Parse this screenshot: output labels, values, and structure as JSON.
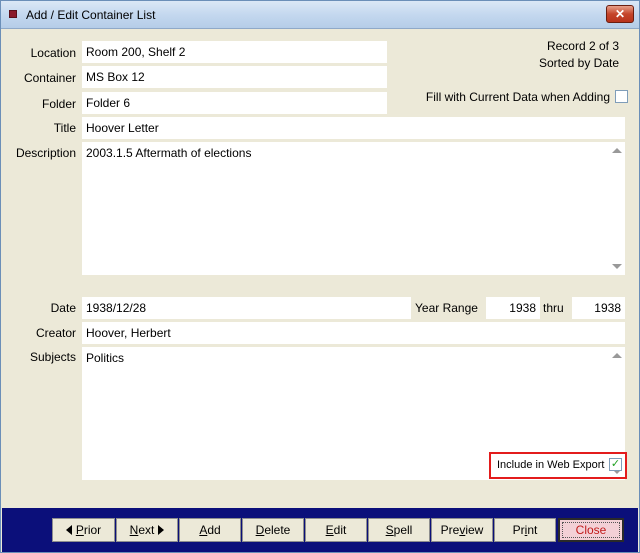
{
  "window": {
    "title": "Add / Edit Container List"
  },
  "status": {
    "record": "Record 2 of 3",
    "sort": "Sorted by Date"
  },
  "fill_option": {
    "label": "Fill with Current Data when Adding",
    "checked": false
  },
  "fields": {
    "location_label": "Location",
    "location": "Room 200, Shelf 2",
    "container_label": "Container",
    "container": "MS Box 12",
    "folder_label": "Folder",
    "folder": "Folder 6",
    "title_label": "Title",
    "title": "Hoover Letter",
    "description_label": "Description",
    "description": "2003.1.5 Aftermath of elections",
    "date_label": "Date",
    "date": "1938/12/28",
    "year_range_label": "Year Range",
    "year_from": "1938",
    "thru_label": "thru",
    "year_to": "1938",
    "creator_label": "Creator",
    "creator": "Hoover, Herbert",
    "subjects_label": "Subjects",
    "subjects": "Politics"
  },
  "web_export": {
    "label": "Include in Web Export",
    "checked": true,
    "check_glyph": "✓"
  },
  "toolbar": {
    "prior_accel": "P",
    "prior_rest": "rior",
    "next_accel": "N",
    "next_rest": "ext",
    "add_accel": "A",
    "add_rest": "dd",
    "delete_accel": "D",
    "delete_rest": "elete",
    "edit_accel": "E",
    "edit_rest": "dit",
    "spell_accel": "S",
    "spell_rest": "pell",
    "preview_pre": "Pre",
    "preview_accel": "v",
    "preview_rest": "iew",
    "print_pre": "Pr",
    "print_accel": "i",
    "print_rest": "nt",
    "close": "Close"
  },
  "colors": {
    "toolbar_bg": "#0b0f7a",
    "highlight": "#e31c1c",
    "title_gradient": "#c4d8ef",
    "close_text": "#c11a1a"
  }
}
